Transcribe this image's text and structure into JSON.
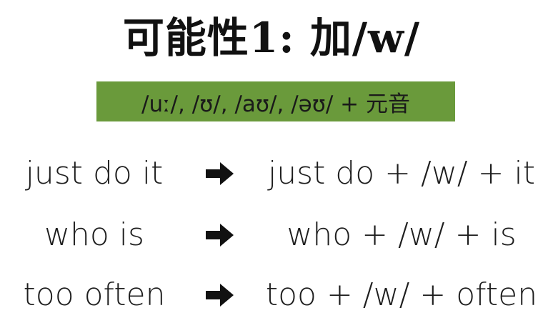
{
  "title": "可能性1: 加/w/",
  "banner": {
    "text": "/uː/, /ʊ/, /aʊ/, /əʊ/ + 元音",
    "color": "#6a9a3b"
  },
  "rows": [
    {
      "left": "just do it",
      "right": "just do + /w/ + it"
    },
    {
      "left": "who is",
      "right": "who + /w/ + is"
    },
    {
      "left": "too often",
      "right": "too + /w/ + often"
    }
  ],
  "icons": {
    "arrow": "arrow-right-icon"
  }
}
